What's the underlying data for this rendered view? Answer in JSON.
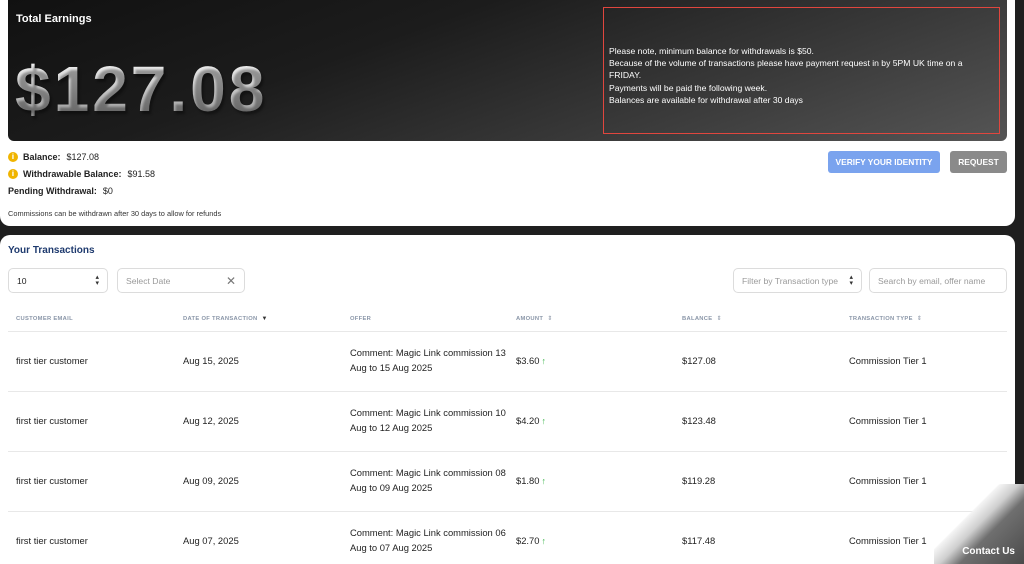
{
  "earnings": {
    "title": "Total Earnings",
    "total": "$127.08",
    "notice_lines": [
      "Please note, minimum balance for withdrawals is $50.",
      "Because of the volume of transactions please have payment request in by 5PM UK time on a FRIDAY.",
      "Payments will be paid the following week.",
      "Balances are available for withdrawal after 30 days"
    ],
    "balance_label": "Balance:",
    "balance_value": "$127.08",
    "withdrawable_label": "Withdrawable Balance:",
    "withdrawable_value": "$91.58",
    "pending_label": "Pending Withdrawal:",
    "pending_value": "$0",
    "commission_note": "Commissions can be withdrawn after 30 days to allow for refunds",
    "verify_label": "VERIFY YOUR IDENTITY",
    "request_label": "REQUEST",
    "colors": {
      "verify": "#7aa3ee",
      "request": "#8a8a8a",
      "notice_border": "#e0463e",
      "info_icon": "#f0b400"
    }
  },
  "transactions": {
    "title": "Your Transactions",
    "page_size": "10",
    "date_placeholder": "Select Date",
    "type_placeholder": "Filter by Transaction type",
    "search_placeholder": "Search by email, offer name",
    "columns": [
      "CUSTOMER EMAIL",
      "DATE OF TRANSACTION",
      "OFFER",
      "AMOUNT",
      "BALANCE",
      "TRANSACTION TYPE"
    ],
    "rows": [
      {
        "email": "first tier customer",
        "date": "Aug 15, 2025",
        "offer": "Comment: Magic Link commission 13 Aug to 15 Aug 2025",
        "amount": "$3.60",
        "balance": "$127.08",
        "type": "Commission Tier 1"
      },
      {
        "email": "first tier customer",
        "date": "Aug 12, 2025",
        "offer": "Comment: Magic Link commission 10 Aug to 12 Aug 2025",
        "amount": "$4.20",
        "balance": "$123.48",
        "type": "Commission Tier 1"
      },
      {
        "email": "first tier customer",
        "date": "Aug 09, 2025",
        "offer": "Comment: Magic Link commission 08 Aug to 09 Aug 2025",
        "amount": "$1.80",
        "balance": "$119.28",
        "type": "Commission Tier 1"
      },
      {
        "email": "first tier customer",
        "date": "Aug 07, 2025",
        "offer": "Comment: Magic Link commission 06 Aug to 07 Aug 2025",
        "amount": "$2.70",
        "balance": "$117.48",
        "type": "Commission Tier 1"
      }
    ]
  },
  "contact": {
    "label": "Contact Us"
  }
}
